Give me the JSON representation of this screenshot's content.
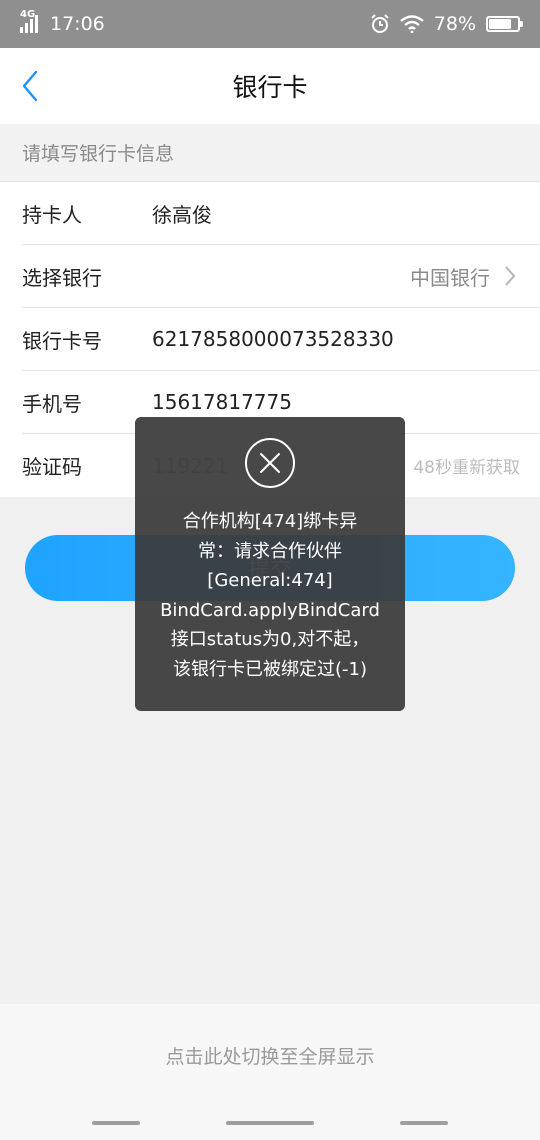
{
  "status_bar": {
    "network": "4G",
    "time": "17:06",
    "battery": "78%",
    "battery_level": 0.78
  },
  "nav": {
    "title": "银行卡",
    "back_icon": "chevron-left-icon"
  },
  "section": {
    "title": "请填写银行卡信息"
  },
  "form": {
    "holder": {
      "label": "持卡人",
      "value": "徐高俊"
    },
    "bank": {
      "label": "选择银行",
      "value": "中国银行"
    },
    "card_number": {
      "label": "银行卡号",
      "value": "6217858000073528330"
    },
    "phone": {
      "label": "手机号",
      "value": "15617817775"
    },
    "code": {
      "label": "验证码",
      "value": "119221",
      "resend": "48秒重新获取"
    }
  },
  "submit": {
    "label": "提交"
  },
  "toast": {
    "icon": "close-circle-icon",
    "message": "合作机构[474]绑卡异\n常：请求合作伙伴\n[General:474]\nBindCard.applyBindCard\n接口status为0,对不起，\n该银行卡已被绑定过(-1)"
  },
  "footer": {
    "hint": "点击此处切换至全屏显示"
  },
  "colors": {
    "accent": "#1fa4ff",
    "status_bar": "#8f8f8f",
    "toast_bg": "#3a3a3a"
  }
}
